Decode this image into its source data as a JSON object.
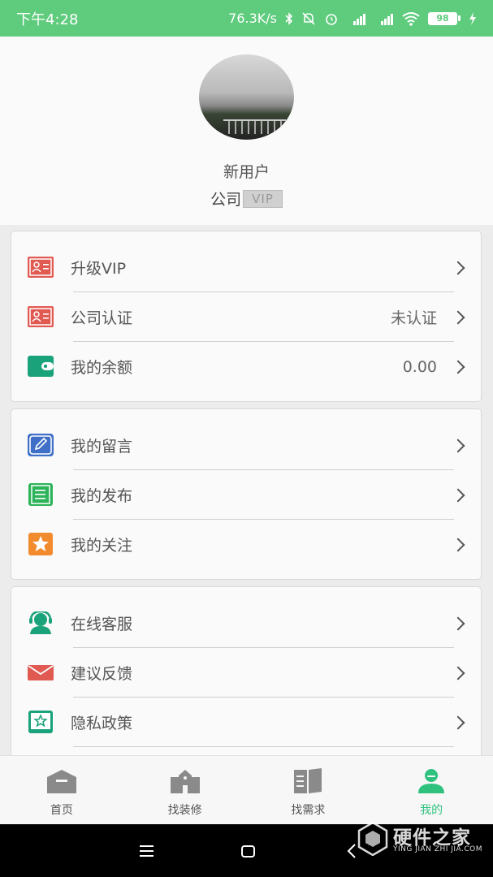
{
  "status_bar": {
    "time": "下午4:28",
    "network_speed": "76.3K/s",
    "battery": "98"
  },
  "profile": {
    "username": "新用户",
    "company": "公司",
    "vip_badge": "VIP"
  },
  "sections": [
    {
      "items": [
        {
          "label": "升级VIP",
          "value": "",
          "icon": "id-card-icon",
          "color": "#e05a52"
        },
        {
          "label": "公司认证",
          "value": "未认证",
          "icon": "id-card-icon",
          "color": "#e05a52"
        },
        {
          "label": "我的余额",
          "value": "0.00",
          "icon": "wallet-icon",
          "color": "#1aa27a"
        }
      ]
    },
    {
      "items": [
        {
          "label": "我的留言",
          "value": "",
          "icon": "edit-icon",
          "color": "#3f6fc6"
        },
        {
          "label": "我的发布",
          "value": "",
          "icon": "notebook-icon",
          "color": "#2db35a"
        },
        {
          "label": "我的关注",
          "value": "",
          "icon": "star-icon",
          "color": "#f28a2e"
        }
      ]
    },
    {
      "items": [
        {
          "label": "在线客服",
          "value": "",
          "icon": "headset-icon",
          "color": "#1aa27a"
        },
        {
          "label": "建议反馈",
          "value": "",
          "icon": "envelope-icon",
          "color": "#e05a52"
        },
        {
          "label": "隐私政策",
          "value": "",
          "icon": "policy-icon",
          "color": "#1aa27a"
        }
      ]
    }
  ],
  "tab_bar": {
    "tabs": [
      {
        "label": "首页",
        "icon": "home-icon"
      },
      {
        "label": "找装修",
        "icon": "building-icon"
      },
      {
        "label": "找需求",
        "icon": "book-icon"
      },
      {
        "label": "我的",
        "icon": "user-icon",
        "active": true
      }
    ]
  },
  "watermark": {
    "title": "硬件之家",
    "subtitle": "YING JIAN ZHI JIA.COM"
  },
  "colors": {
    "accent": "#5ecb7d",
    "active_tab": "#2ec27e"
  }
}
